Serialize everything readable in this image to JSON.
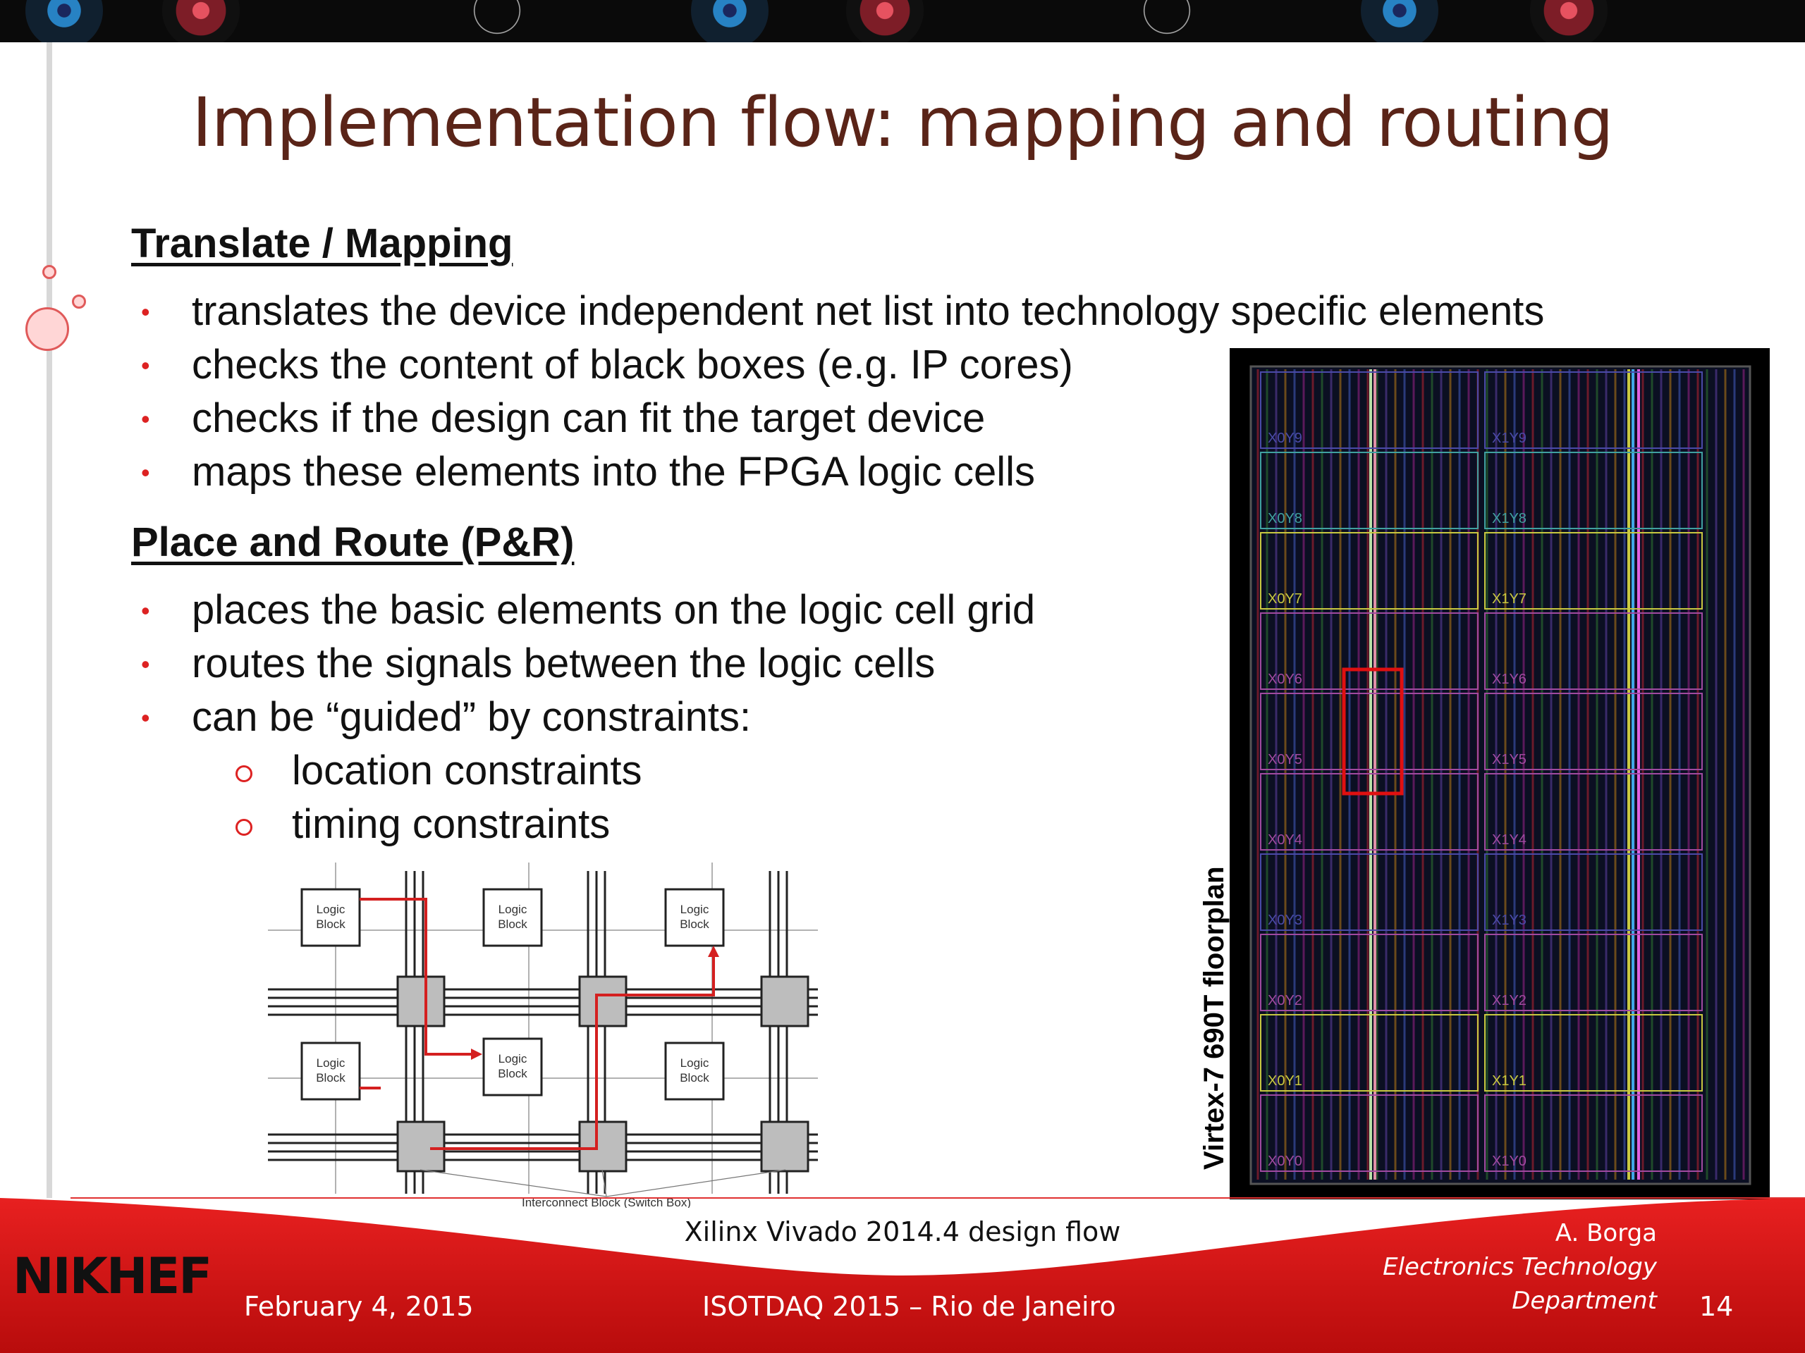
{
  "slide": {
    "title": "Implementation flow: mapping and routing"
  },
  "translate_section": {
    "heading": "Translate / Mapping",
    "bullets": [
      "translates the device independent net list into technology specific elements",
      "checks the content of black boxes (e.g. IP cores)",
      "checks if the design can fit the target device",
      "maps these elements into the FPGA logic cells"
    ]
  },
  "par_section": {
    "heading": "Place and Route (P&R)",
    "bullets": [
      "places the basic elements on the logic cell grid",
      "routes the signals between the logic cells",
      "can be “guided” by constraints:"
    ],
    "sub_bullets": [
      "location constraints",
      "timing constraints"
    ]
  },
  "routing_diagram": {
    "logic_block_label_line1": "Logic",
    "logic_block_label_line2": "Block",
    "interconnect_label": "Interconnect Block (Switch Box)",
    "route_color": "#d42020"
  },
  "floorplan": {
    "caption": "Virtex-7 690T floorplan",
    "regions_left": [
      "X0Y9",
      "X0Y8",
      "X0Y7",
      "X0Y6",
      "X0Y5",
      "X0Y4",
      "X0Y3",
      "X0Y2",
      "X0Y1",
      "X0Y0"
    ],
    "regions_right": [
      "X1Y9",
      "X1Y8",
      "X1Y7",
      "X1Y6",
      "X1Y5",
      "X1Y4",
      "X1Y3",
      "X1Y2",
      "X1Y1",
      "X1Y0"
    ],
    "highlight_color": "#e01010"
  },
  "footer": {
    "date": "February 4, 2015",
    "event": "ISOTDAQ 2015 – Rio de Janeiro",
    "caption": "Xilinx Vivado 2014.4 design flow",
    "author": "A. Borga",
    "department_line1": "Electronics Technology",
    "department_line2": "Department",
    "page_number": "14",
    "logo_text": "NIKHEF"
  },
  "colors": {
    "title": "#5a2418",
    "bullet_marker": "#dd2222",
    "footer_red": "#d81414"
  }
}
